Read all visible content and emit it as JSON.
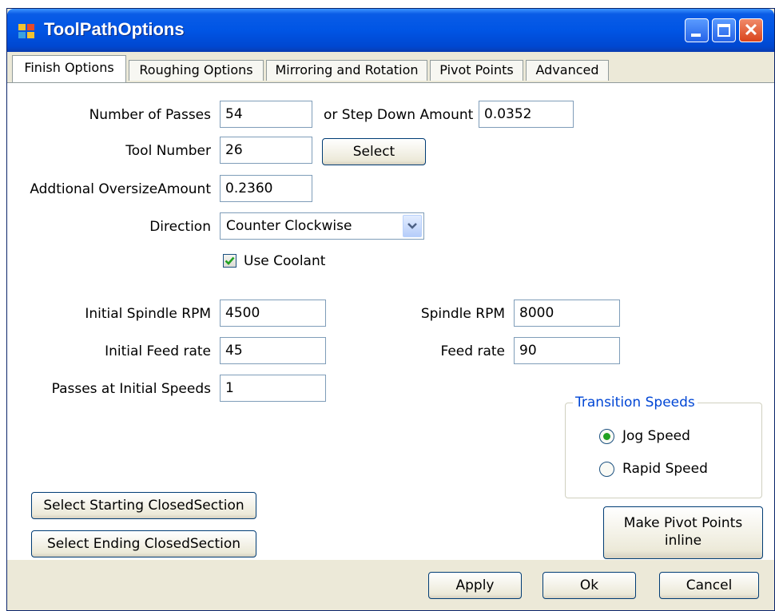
{
  "window": {
    "title": "ToolPathOptions"
  },
  "tabs": [
    {
      "label": "Finish Options",
      "active": true
    },
    {
      "label": "Roughing Options"
    },
    {
      "label": "Mirroring and Rotation"
    },
    {
      "label": "Pivot Points"
    },
    {
      "label": "Advanced"
    }
  ],
  "form": {
    "passes_label": "Number of Passes",
    "passes_value": "54",
    "stepdown_label": "or Step Down Amount",
    "stepdown_value": "0.0352",
    "tool_label": "Tool Number",
    "tool_value": "26",
    "select_button": "Select",
    "oversize_label": "Addtional OversizeAmount",
    "oversize_value": "0.2360",
    "direction_label": "Direction",
    "direction_value": "Counter Clockwise",
    "coolant_label": "Use Coolant",
    "coolant_checked": true,
    "init_spindle_label": "Initial Spindle RPM",
    "init_spindle_value": "4500",
    "spindle_label": "Spindle RPM",
    "spindle_value": "8000",
    "init_feed_label": "Initial Feed rate",
    "init_feed_value": "45",
    "feed_label": "Feed rate",
    "feed_value": "90",
    "passes_initial_label": "Passes at Initial Speeds",
    "passes_initial_value": "1"
  },
  "transition": {
    "title": "Transition Speeds",
    "options": [
      {
        "label": "Jog Speed",
        "selected": true
      },
      {
        "label": "Rapid Speed",
        "selected": false
      }
    ]
  },
  "buttons": {
    "select_start": "Select Starting ClosedSection",
    "select_end": "Select Ending ClosedSection",
    "make_pivot_line1": "Make Pivot Points",
    "make_pivot_line2": "inline",
    "apply": "Apply",
    "ok": "Ok",
    "cancel": "Cancel"
  },
  "colors": {
    "titlebar": "#0055e5",
    "dialog_bg": "#ece9d8",
    "group_title": "#0046d5",
    "radio_dot": "#21a121",
    "checkmark": "#21a121"
  },
  "icons": {
    "app": "app-grid-icon",
    "minimize": "minimize-icon",
    "maximize": "maximize-icon",
    "close": "close-icon",
    "dropdown": "chevron-down-icon",
    "check": "checkmark-icon"
  }
}
